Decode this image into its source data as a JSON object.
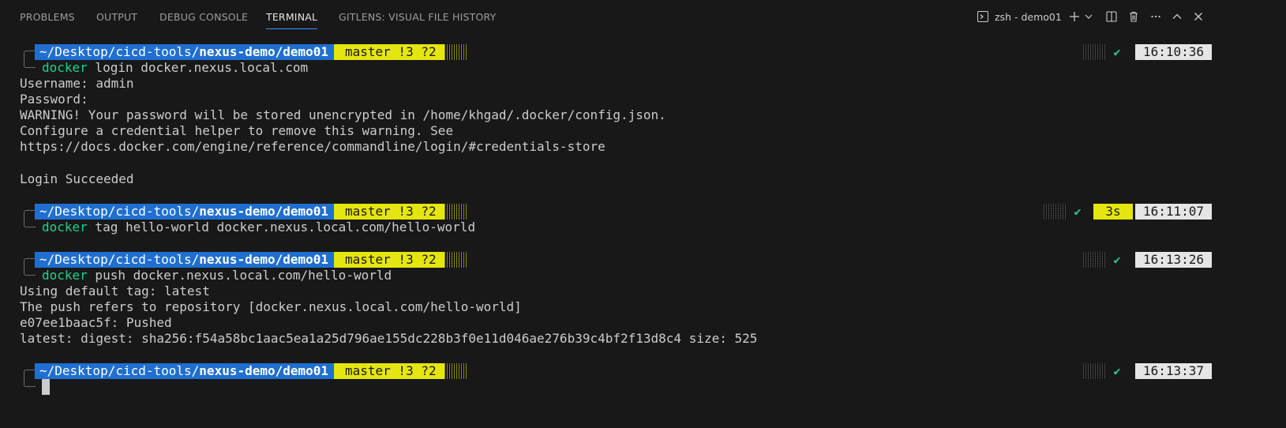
{
  "tabs": [
    {
      "label": "PROBLEMS"
    },
    {
      "label": "OUTPUT"
    },
    {
      "label": "DEBUG CONSOLE"
    },
    {
      "label": "TERMINAL",
      "active": true
    },
    {
      "label": "GITLENS: VISUAL FILE HISTORY"
    }
  ],
  "terminal_selector": {
    "label": "zsh - demo01"
  },
  "prompt": {
    "path_prefix": "~/Desktop/cicd-tools/",
    "path_bold": "nexus-demo/demo01",
    "git": "master !3 ?2",
    "check": "✔"
  },
  "blocks": [
    {
      "time": "16:10:36",
      "duration": "",
      "cmd_name": "docker",
      "cmd_args": " login docker.nexus.local.com",
      "output": [
        "Username: admin",
        "Password:",
        "WARNING! Your password will be stored unencrypted in /home/khgad/.docker/config.json.",
        "Configure a credential helper to remove this warning. See",
        "https://docs.docker.com/engine/reference/commandline/login/#credentials-store",
        "",
        "Login Succeeded"
      ]
    },
    {
      "time": "16:11:07",
      "duration": "3s",
      "cmd_name": "docker",
      "cmd_args": " tag hello-world docker.nexus.local.com/hello-world",
      "output": []
    },
    {
      "time": "16:13:26",
      "duration": "",
      "cmd_name": "docker",
      "cmd_args": " push docker.nexus.local.com/hello-world",
      "output": [
        "Using default tag: latest",
        "The push refers to repository [docker.nexus.local.com/hello-world]",
        "e07ee1baac5f: Pushed",
        "latest: digest: sha256:f54a58bc1aac5ea1a25d796ae155dc228b3f0e11d046ae276b39c4bf2f13d8c4 size: 525"
      ]
    },
    {
      "time": "16:13:37",
      "duration": "",
      "cmd_name": "",
      "cmd_args": "",
      "output": []
    }
  ],
  "colors": {
    "path_bg": "#1f6fd0",
    "git_bg": "#e5e510",
    "time_bg": "#e5e5e5",
    "cmd_green": "#23d18b",
    "accent": "#3794ff"
  }
}
